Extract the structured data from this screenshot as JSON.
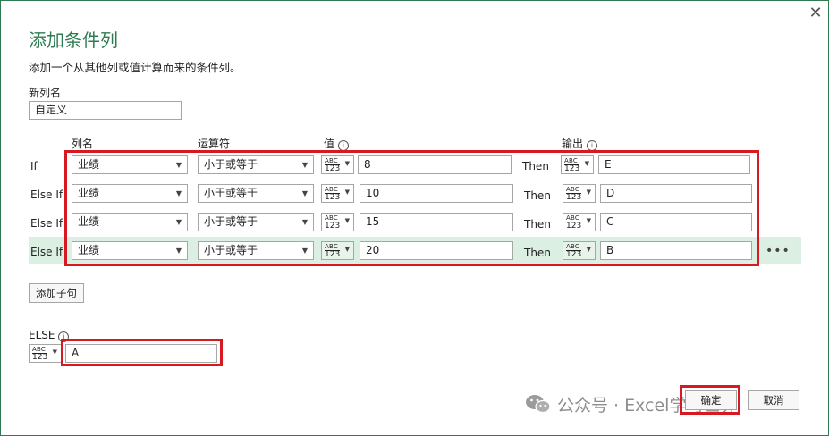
{
  "dialog": {
    "title": "添加条件列",
    "description": "添加一个从其他列或值计算而来的条件列。",
    "close_glyph": "✕"
  },
  "new_column": {
    "label": "新列名",
    "value": "自定义"
  },
  "headers": {
    "column_name": "列名",
    "operator": "运算符",
    "value": "值",
    "output": "输出",
    "info_glyph": "i"
  },
  "type_selector": {
    "line1": "ABC",
    "line2": "123"
  },
  "rows": [
    {
      "label": "If",
      "column": "业绩",
      "operator": "小于或等于",
      "value": "8",
      "then": "Then",
      "output": "E"
    },
    {
      "label": "Else If",
      "column": "业绩",
      "operator": "小于或等于",
      "value": "10",
      "then": "Then",
      "output": "D"
    },
    {
      "label": "Else If",
      "column": "业绩",
      "operator": "小于或等于",
      "value": "15",
      "then": "Then",
      "output": "C"
    },
    {
      "label": "Else If",
      "column": "业绩",
      "operator": "小于或等于",
      "value": "20",
      "then": "Then",
      "output": "B"
    }
  ],
  "more_glyph": "•••",
  "add_clause_label": "添加子句",
  "else": {
    "label": "ELSE",
    "value": "A"
  },
  "buttons": {
    "ok": "确定",
    "cancel": "取消"
  },
  "watermark": {
    "text": "公众号 · Excel学习世界"
  },
  "colors": {
    "title_green": "#2e7d52",
    "highlight_row": "#dcefe3",
    "annotation_red": "#d71a21"
  }
}
